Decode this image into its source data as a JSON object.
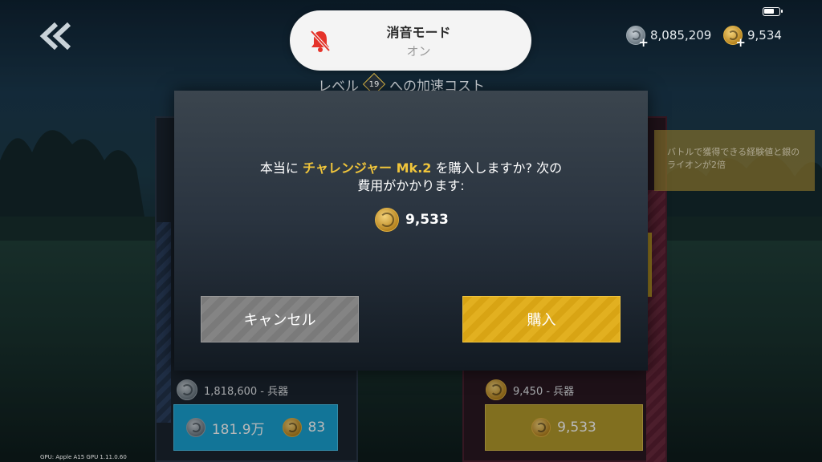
{
  "hud": {
    "silver_amount": "8,085,209",
    "gold_amount": "9,534"
  },
  "notification": {
    "title": "消音モード",
    "subtitle": "オン"
  },
  "header": {
    "prefix": "レベル",
    "level": "19",
    "suffix": "への加速コスト"
  },
  "dialog": {
    "line1_before": "本当に ",
    "vehicle_name": "チャレンジャー Mk.2",
    "line1_after": " を購入しますか? 次の",
    "line2": "費用がかかります:",
    "price": "9,533",
    "cancel_label": "キャンセル",
    "buy_label": "購入"
  },
  "cards": {
    "left": {
      "cost_text": "1,818,600 - 兵器",
      "buy_silver": "181.9万",
      "buy_gold": "83"
    },
    "right": {
      "cost_text": "9,450 - 兵器",
      "buy_gold": "9,533"
    }
  },
  "bonus": {
    "text_line1": "バトルで獲得できる経験値と銀の",
    "text_line2": "ライオンが2倍"
  },
  "footer": {
    "gpu": "GPU: Apple A15 GPU    1.11.0.60"
  },
  "colors": {
    "accent_gold": "#f0c53b",
    "buy_button": "#e2b020",
    "cancel_button": "#848484",
    "left_buy": "#1aa3d3",
    "silent_icon": "#e5332a"
  }
}
